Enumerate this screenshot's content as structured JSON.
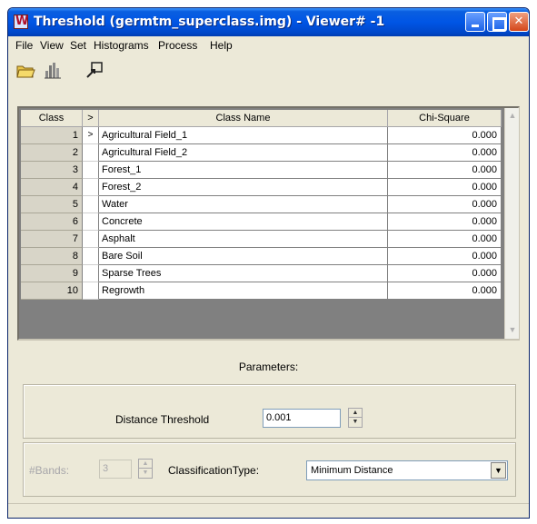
{
  "window": {
    "title": "Threshold (germtm_superclass.img) - Viewer# -1"
  },
  "menu": [
    "File",
    "View",
    "Set",
    "Histograms",
    "Process",
    "Help"
  ],
  "toolbar": {
    "icons": [
      "open-folder-icon",
      "histogram-icon",
      "select-pointer-icon"
    ]
  },
  "table": {
    "headers": {
      "class": "Class",
      "marker": ">",
      "name": "Class Name",
      "chi": "Chi-Square"
    },
    "current_row_marker": ">",
    "rows": [
      {
        "num": "1",
        "name": "Agricultural Field_1",
        "chi": "0.000"
      },
      {
        "num": "2",
        "name": "Agricultural Field_2",
        "chi": "0.000"
      },
      {
        "num": "3",
        "name": "Forest_1",
        "chi": "0.000"
      },
      {
        "num": "4",
        "name": "Forest_2",
        "chi": "0.000"
      },
      {
        "num": "5",
        "name": "Water",
        "chi": "0.000"
      },
      {
        "num": "6",
        "name": "Concrete",
        "chi": "0.000"
      },
      {
        "num": "7",
        "name": "Asphalt",
        "chi": "0.000"
      },
      {
        "num": "8",
        "name": "Bare Soil",
        "chi": "0.000"
      },
      {
        "num": "9",
        "name": "Sparse Trees",
        "chi": "0.000"
      },
      {
        "num": "10",
        "name": "Regrowth",
        "chi": "0.000"
      }
    ]
  },
  "parameters": {
    "title": "Parameters:",
    "distance_threshold_label": "Distance Threshold",
    "distance_threshold_value": "0.001",
    "bands_label": "#Bands:",
    "bands_value": "3",
    "classification_type_label": "ClassificationType:",
    "classification_type_value": "Minimum Distance"
  }
}
